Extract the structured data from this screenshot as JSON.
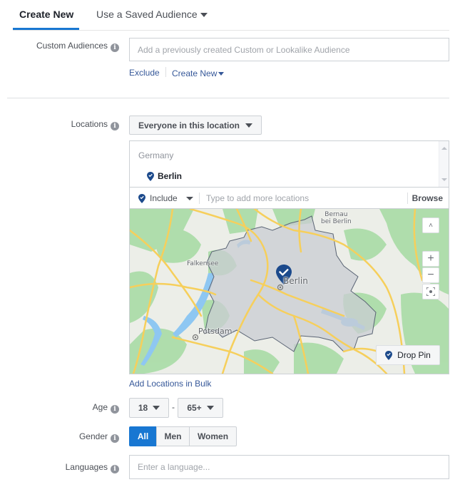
{
  "tabs": {
    "create_new": "Create New",
    "saved_audience": "Use a Saved Audience"
  },
  "custom_audiences": {
    "label": "Custom Audiences",
    "placeholder": "Add a previously created Custom or Lookalike Audience",
    "exclude": "Exclude",
    "create_new": "Create New"
  },
  "locations": {
    "label": "Locations",
    "mode": "Everyone in this location",
    "country": "Germany",
    "selected": [
      {
        "name": "Berlin"
      }
    ],
    "include_label": "Include",
    "input_placeholder": "Type to add more locations",
    "browse": "Browse",
    "map": {
      "labels": {
        "bernau": "Bernau",
        "bernau2": "bei Berlin",
        "falkensee": "Falkensee",
        "berlin": "Berlin",
        "potsdam": "Potsdam"
      },
      "zoom_in": "+",
      "zoom_out": "−",
      "collapse": "˄",
      "drop_pin": "Drop Pin"
    },
    "bulk": "Add Locations in Bulk"
  },
  "age": {
    "label": "Age",
    "min": "18",
    "separator": "-",
    "max": "65+"
  },
  "gender": {
    "label": "Gender",
    "options": [
      "All",
      "Men",
      "Women"
    ],
    "selected": "All"
  },
  "languages": {
    "label": "Languages",
    "placeholder": "Enter a language..."
  },
  "colors": {
    "accent": "#1877d2",
    "link": "#365899",
    "pin": "#1c4a8c"
  }
}
